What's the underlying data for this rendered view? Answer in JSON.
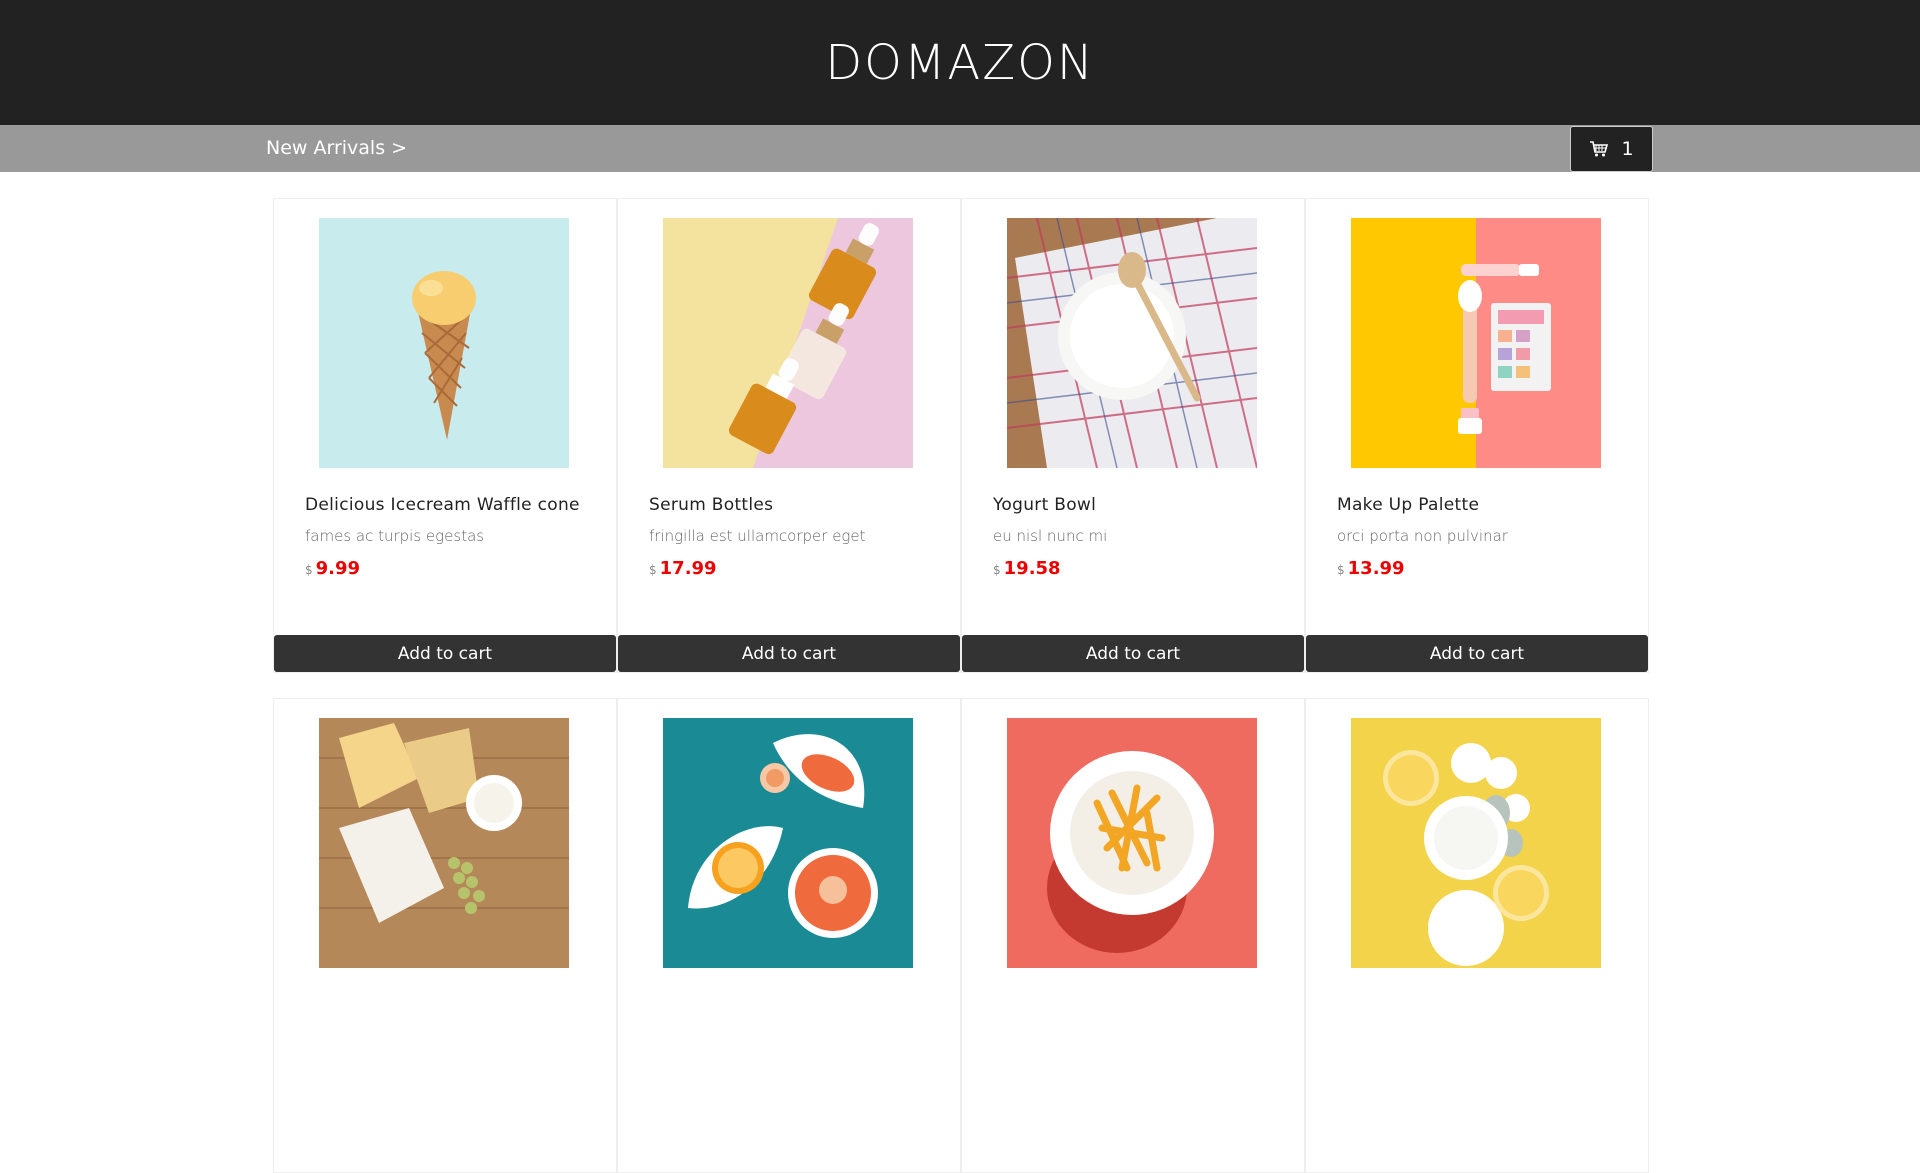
{
  "header": {
    "brand": "DOMAZON"
  },
  "subnav": {
    "breadcrumb": "New Arrivals >",
    "cart_count": "1",
    "cart_icon": "shopping-cart-icon"
  },
  "products": [
    {
      "name": "Delicious Icecream Waffle cone",
      "desc": "fames ac turpis egestas",
      "currency": "$",
      "price": "9.99",
      "button": "Add to cart"
    },
    {
      "name": "Serum Bottles",
      "desc": "fringilla est ullamcorper eget",
      "currency": "$",
      "price": "17.99",
      "button": "Add to cart"
    },
    {
      "name": "Yogurt Bowl",
      "desc": "eu nisl nunc mi",
      "currency": "$",
      "price": "19.58",
      "button": "Add to cart"
    },
    {
      "name": "Make Up Palette",
      "desc": "orci porta non pulvinar",
      "currency": "$",
      "price": "13.99",
      "button": "Add to cart"
    }
  ],
  "colors": {
    "header_bg": "#222222",
    "subbar_bg": "#999999",
    "price": "#ee0000",
    "button_bg": "#333333"
  }
}
